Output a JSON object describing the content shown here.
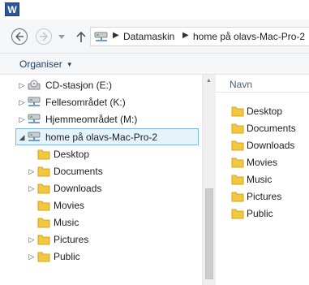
{
  "titlebar": {
    "app_icon_letter": "W",
    "app_icon_name": "word-icon"
  },
  "navigation": {
    "back_icon": "back-arrow-icon",
    "forward_icon": "forward-arrow-icon",
    "up_icon": "up-arrow-icon",
    "address": {
      "icon": "network-drive-icon",
      "segments": [
        "Datamaskin",
        "home på olavs-Mac-Pro-2"
      ],
      "separator_icon": "chevron-right-icon"
    }
  },
  "commandbar": {
    "organise_label": "Organiser",
    "organise_caret": "▼"
  },
  "navpane": {
    "items": [
      {
        "label": "CD-stasjon (E:)",
        "icon": "cd-drive-icon",
        "expander": "▷",
        "level": 0,
        "selected": false
      },
      {
        "label": "Fellesområdet (K:)",
        "icon": "network-drive-icon",
        "expander": "▷",
        "level": 0,
        "selected": false
      },
      {
        "label": "Hjemmeområdet (M:)",
        "icon": "network-drive-icon",
        "expander": "▷",
        "level": 0,
        "selected": false
      },
      {
        "label": "home på olavs-Mac-Pro-2",
        "icon": "network-drive-icon",
        "expander": "◢",
        "level": 0,
        "selected": true
      },
      {
        "label": "Desktop",
        "icon": "folder-icon",
        "expander": "",
        "level": 1,
        "selected": false
      },
      {
        "label": "Documents",
        "icon": "folder-icon",
        "expander": "▷",
        "level": 1,
        "selected": false
      },
      {
        "label": "Downloads",
        "icon": "folder-icon",
        "expander": "▷",
        "level": 1,
        "selected": false
      },
      {
        "label": "Movies",
        "icon": "folder-icon",
        "expander": "",
        "level": 1,
        "selected": false
      },
      {
        "label": "Music",
        "icon": "folder-icon",
        "expander": "",
        "level": 1,
        "selected": false
      },
      {
        "label": "Pictures",
        "icon": "folder-icon",
        "expander": "▷",
        "level": 1,
        "selected": false
      },
      {
        "label": "Public",
        "icon": "folder-icon",
        "expander": "▷",
        "level": 1,
        "selected": false
      }
    ]
  },
  "scrollbar": {
    "up_arrow": "▲",
    "down_arrow": "▼"
  },
  "content": {
    "column_header": "Navn",
    "files": [
      {
        "label": "Desktop",
        "icon": "folder-icon"
      },
      {
        "label": "Documents",
        "icon": "folder-icon"
      },
      {
        "label": "Downloads",
        "icon": "folder-icon"
      },
      {
        "label": "Movies",
        "icon": "folder-icon"
      },
      {
        "label": "Music",
        "icon": "folder-icon"
      },
      {
        "label": "Pictures",
        "icon": "folder-icon"
      },
      {
        "label": "Public",
        "icon": "folder-icon"
      }
    ]
  },
  "colors": {
    "selection_bg": "#e5f3fb",
    "selection_border": "#7eb4ea",
    "folder": "#f3c83f",
    "toolbar_bg": "#f5f6f7",
    "accent_text": "#1e3f73"
  }
}
